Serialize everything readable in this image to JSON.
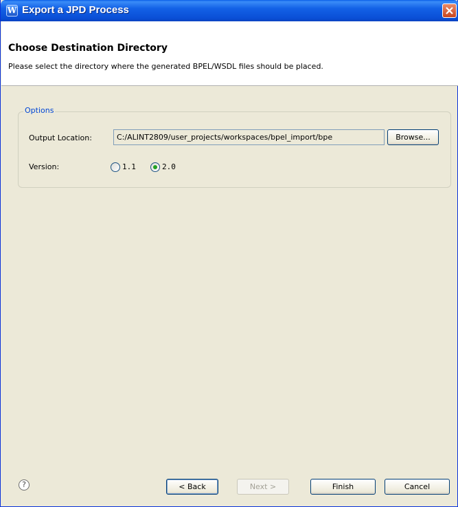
{
  "window": {
    "title": "Export a JPD Process",
    "app_icon_glyph": "W"
  },
  "header": {
    "title": "Choose Destination Directory",
    "description": "Please select the directory where the generated BPEL/WSDL files should be placed."
  },
  "options": {
    "legend": "Options",
    "output_location_label": "Output Location:",
    "output_location_value": "C:/ALINT2809/user_projects/workspaces/bpel_import/bpe",
    "browse_label": "Browse...",
    "version_label": "Version:",
    "versions": [
      {
        "label": "1.1",
        "selected": false
      },
      {
        "label": "2.0",
        "selected": true
      }
    ]
  },
  "footer": {
    "help_glyph": "?",
    "back_label": "< Back",
    "next_label": "Next >",
    "finish_label": "Finish",
    "cancel_label": "Cancel"
  },
  "colors": {
    "titlebar": "#0a4fd6",
    "legend": "#0046d5",
    "radio_selected": "#21a121"
  }
}
